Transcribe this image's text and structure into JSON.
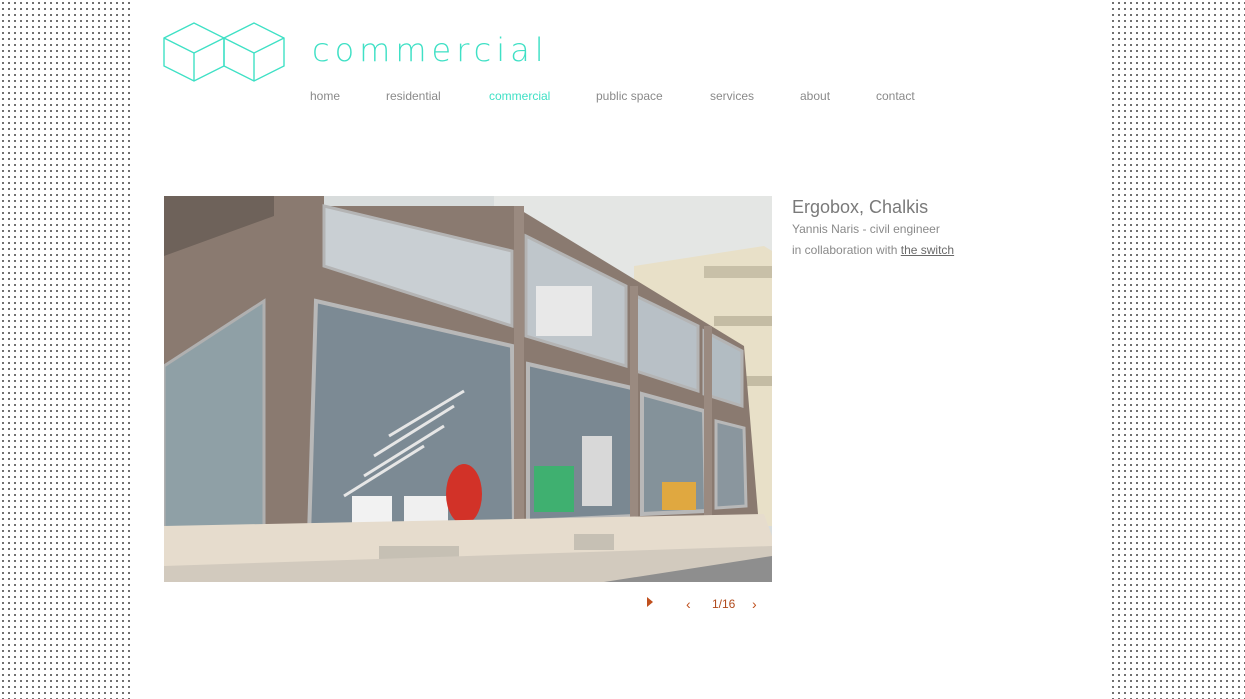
{
  "header": {
    "section_title": "commercial",
    "logo_icon": "cube-outline-logo"
  },
  "nav": {
    "items": [
      {
        "label": "home",
        "active": false
      },
      {
        "label": "residential",
        "active": false
      },
      {
        "label": "commercial",
        "active": true
      },
      {
        "label": "public space",
        "active": false
      },
      {
        "label": "services",
        "active": false
      },
      {
        "label": "about",
        "active": false
      },
      {
        "label": "contact",
        "active": false
      }
    ]
  },
  "project": {
    "title": "Ergobox, Chalkis",
    "engineer": "Yannis Naris - civil engineer",
    "collab_prefix": "in collaboration with",
    "collab_link": "the switch"
  },
  "gallery": {
    "counter": "1/16",
    "play_icon": "play-icon",
    "prev_icon": "chevron-left-icon",
    "next_icon": "chevron-right-icon"
  },
  "colors": {
    "accent": "#3fe0c5",
    "pager": "#c0501e",
    "text": "#8a8a8a"
  }
}
